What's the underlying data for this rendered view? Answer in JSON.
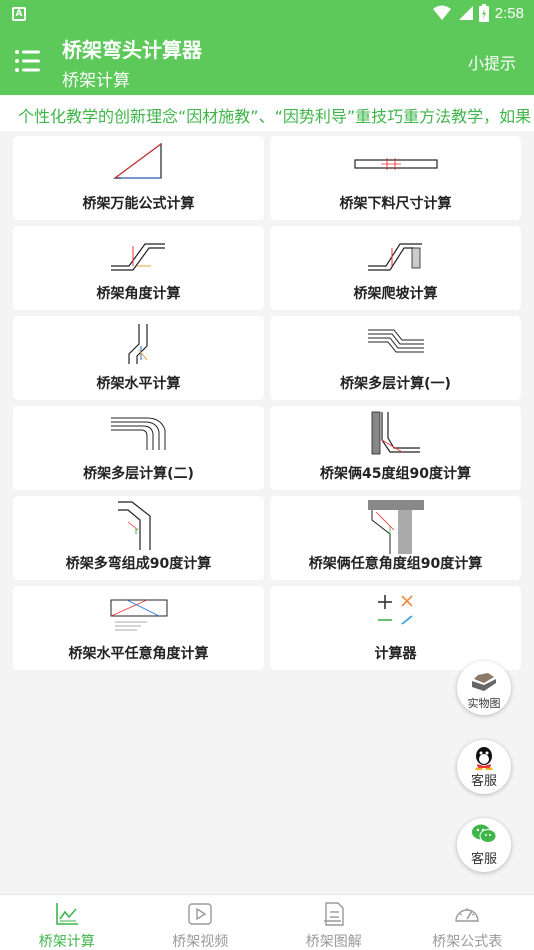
{
  "statusbar": {
    "time": "2:58",
    "notification_glyph": "A"
  },
  "appbar": {
    "title": "桥架弯头计算器",
    "subtitle": "桥架计算",
    "tip": "小提示"
  },
  "marquee": {
    "text": "个性化教学的创新理念“因材施教”、“因势利导”重技巧重方法教学，如果"
  },
  "cards": [
    {
      "label": "桥架万能公式计算",
      "icon": "triangle-diagram-icon"
    },
    {
      "label": "桥架下料尺寸计算",
      "icon": "cut-size-diagram-icon"
    },
    {
      "label": "桥架角度计算",
      "icon": "angle-diagram-icon"
    },
    {
      "label": "桥架爬坡计算",
      "icon": "slope-diagram-icon"
    },
    {
      "label": "桥架水平计算",
      "icon": "horizontal-diagram-icon"
    },
    {
      "label": "桥架多层计算(一)",
      "icon": "multilayer-diagram-icon"
    },
    {
      "label": "桥架多层计算(二)",
      "icon": "multilayer-bend-diagram-icon"
    },
    {
      "label": "桥架俩45度组90度计算",
      "icon": "two-45-diagram-icon"
    },
    {
      "label": "桥架多弯组成90度计算",
      "icon": "multi-bend-diagram-icon"
    },
    {
      "label": "桥架俩任意角度组90度计算",
      "icon": "two-any-angle-diagram-icon"
    },
    {
      "label": "桥架水平任意角度计算",
      "icon": "horizontal-any-angle-diagram-icon"
    },
    {
      "label": "计算器",
      "icon": "calculator-icon"
    }
  ],
  "fabs": [
    {
      "label": "实物图",
      "icon": "photo-icon"
    },
    {
      "label": "客服",
      "icon": "qq-icon"
    },
    {
      "label": "客服",
      "icon": "wechat-icon"
    }
  ],
  "bottomnav": [
    {
      "label": "桥架计算",
      "icon": "chart-icon",
      "active": true
    },
    {
      "label": "桥架视频",
      "icon": "video-icon",
      "active": false
    },
    {
      "label": "桥架图解",
      "icon": "document-icon",
      "active": false
    },
    {
      "label": "桥架公式表",
      "icon": "gauge-icon",
      "active": false
    }
  ],
  "colors": {
    "primary": "#5cc95a",
    "accent_text": "#3fb54a",
    "background": "#f4f4f4"
  }
}
